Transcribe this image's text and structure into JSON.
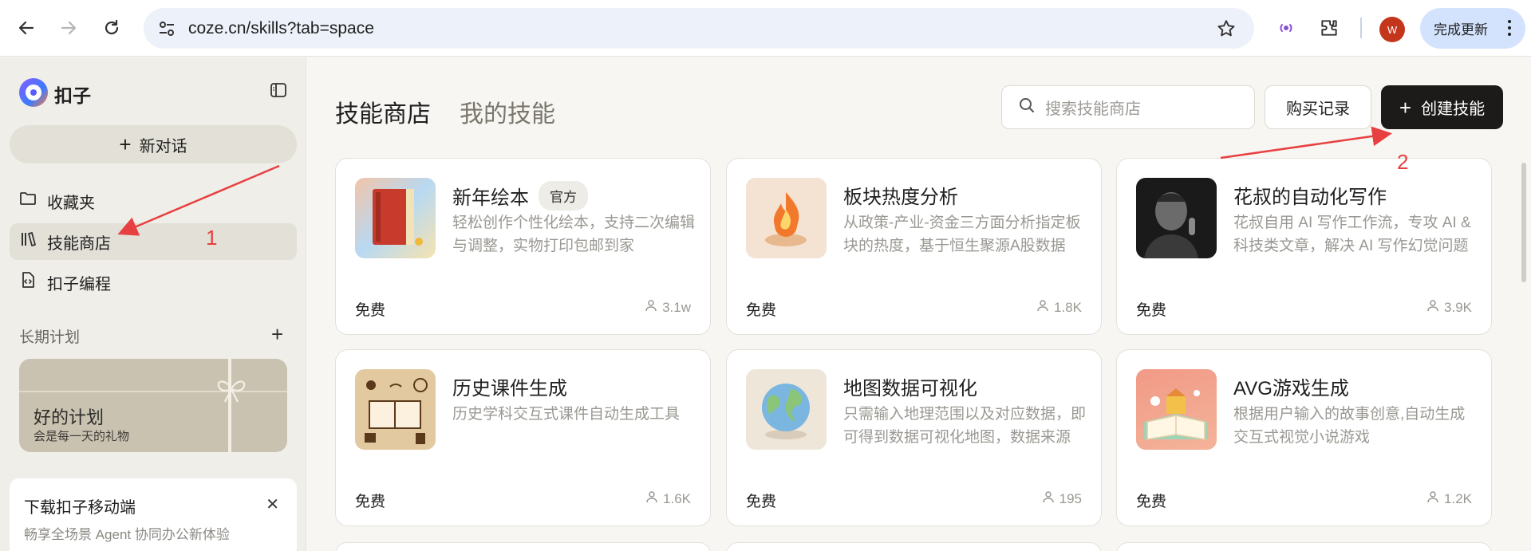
{
  "browser": {
    "url": "coze.cn/skills?tab=space",
    "avatar_letter": "W",
    "update_label": "完成更新"
  },
  "sidebar": {
    "brand": "扣子",
    "new_chat": "新对话",
    "items": [
      {
        "label": "收藏夹",
        "icon": "folder-icon"
      },
      {
        "label": "技能商店",
        "icon": "library-icon",
        "active": true
      },
      {
        "label": "扣子编程",
        "icon": "code-file-icon"
      }
    ],
    "section_title": "长期计划",
    "plan_card": {
      "title": "好的计划",
      "subtitle": "会是每一天的礼物"
    },
    "download": {
      "title": "下载扣子移动端",
      "subtitle": "畅享全场景 Agent 协同办公新体验"
    }
  },
  "main": {
    "tabs": [
      "技能商店",
      "我的技能"
    ],
    "search_placeholder": "搜索技能商店",
    "purchase_history": "购买记录",
    "create_skill": "创建技能",
    "cards": [
      {
        "title": "新年绘本",
        "badge": "官方",
        "desc": "轻松创作个性化绘本，支持二次编辑与调整，实物打印包邮到家",
        "price": "免费",
        "users": "3.1w"
      },
      {
        "title": "板块热度分析",
        "badge": "",
        "desc": "从政策-产业-资金三方面分析指定板块的热度，基于恒生聚源A股数据",
        "price": "免费",
        "users": "1.8K"
      },
      {
        "title": "花叔的自动化写作",
        "badge": "",
        "desc": "花叔自用 AI 写作工作流，专攻 AI & 科技类文章，解决 AI 写作幻觉问题",
        "price": "免费",
        "users": "3.9K"
      },
      {
        "title": "历史课件生成",
        "badge": "",
        "desc": "历史学科交互式课件自动生成工具",
        "price": "免费",
        "users": "1.6K"
      },
      {
        "title": "地图数据可视化",
        "badge": "",
        "desc": "只需输入地理范围以及对应数据，即可得到数据可视化地图，数据来源",
        "price": "免费",
        "users": "195"
      },
      {
        "title": "AVG游戏生成",
        "badge": "",
        "desc": "根据用户输入的故事创意,自动生成交互式视觉小说游戏",
        "price": "免费",
        "users": "1.2K"
      }
    ]
  },
  "annotations": [
    "1",
    "2"
  ],
  "colors": {
    "accent": "#1c1b1a",
    "annotation": "#e84040",
    "sidebar": "#efeee9"
  }
}
